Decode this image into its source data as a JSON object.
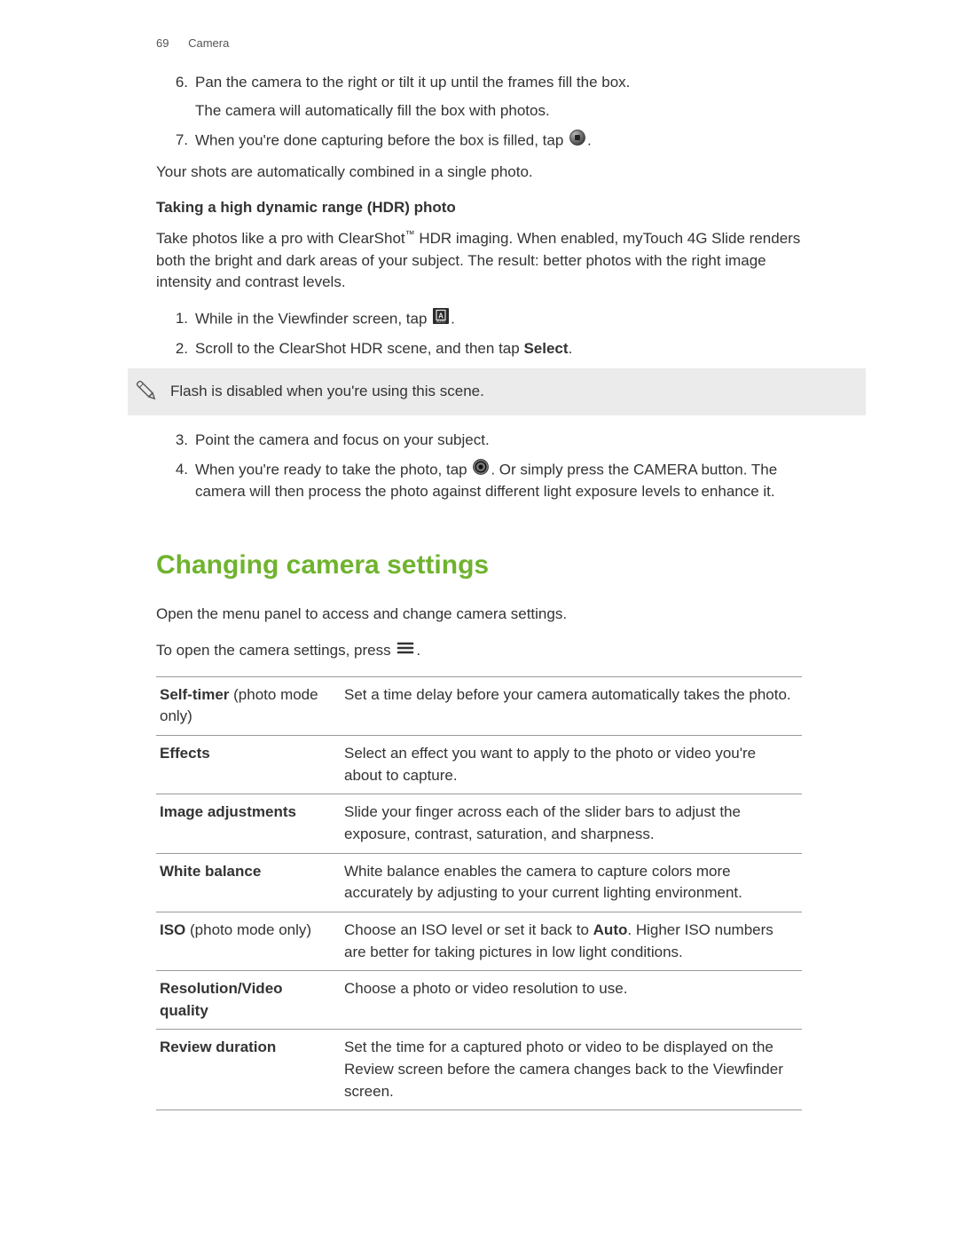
{
  "header": {
    "page_number": "69",
    "section": "Camera"
  },
  "steps_top": {
    "step6_num": "6.",
    "step6_line1": "Pan the camera to the right or tilt it up until the frames fill the box.",
    "step6_line2": "The camera will automatically fill the box with photos.",
    "step7_num": "7.",
    "step7_before": "When you're done capturing before the box is filled, tap ",
    "step7_after": "."
  },
  "after_steps": "Your shots are automatically combined in a single photo.",
  "hdr": {
    "heading": "Taking a high dynamic range (HDR) photo",
    "intro_before_tm": "Take photos like a pro with ClearShot",
    "intro_tm": "™",
    "intro_after_tm": " HDR imaging. When enabled, myTouch 4G Slide renders both the bright and dark areas of your subject. The result: better photos with the right image intensity and contrast levels.",
    "step1_num": "1.",
    "step1_before": "While in the Viewfinder screen, tap ",
    "step1_after": ".",
    "step2_num": "2.",
    "step2_before": "Scroll to the ClearShot HDR scene, and then tap ",
    "step2_bold": "Select",
    "step2_after": ".",
    "note": "Flash is disabled when you're using this scene.",
    "step3_num": "3.",
    "step3_text": "Point the camera and focus on your subject.",
    "step4_num": "4.",
    "step4_before": "When you're ready to take the photo, tap ",
    "step4_after": ". Or simply press the CAMERA button. The camera will then process the photo against different light exposure levels to enhance it."
  },
  "settings": {
    "heading": "Changing camera settings",
    "intro": "Open the menu panel to access and change camera settings.",
    "open_before": "To open the camera settings, press ",
    "open_after": ".",
    "rows": [
      {
        "name_bold": "Self-timer",
        "name_rest": " (photo mode only)",
        "desc_before": "Set a time delay before your camera automatically takes the photo.",
        "desc_bold": "",
        "desc_after": ""
      },
      {
        "name_bold": "Effects",
        "name_rest": "",
        "desc_before": "Select an effect you want to apply to the photo or video you're about to capture.",
        "desc_bold": "",
        "desc_after": ""
      },
      {
        "name_bold": "Image adjustments",
        "name_rest": "",
        "desc_before": "Slide your finger across each of the slider bars to adjust the exposure, contrast, saturation, and sharpness.",
        "desc_bold": "",
        "desc_after": ""
      },
      {
        "name_bold": "White balance",
        "name_rest": "",
        "desc_before": "White balance enables the camera to capture colors more accurately by adjusting to your current lighting environment.",
        "desc_bold": "",
        "desc_after": ""
      },
      {
        "name_bold": "ISO",
        "name_rest": " (photo mode only)",
        "desc_before": "Choose an ISO level or set it back to ",
        "desc_bold": "Auto",
        "desc_after": ". Higher ISO numbers are better for taking pictures in low light conditions."
      },
      {
        "name_bold": "Resolution/Video quality",
        "name_rest": "",
        "desc_before": "Choose a photo or video resolution to use.",
        "desc_bold": "",
        "desc_after": ""
      },
      {
        "name_bold": "Review duration",
        "name_rest": "",
        "desc_before": "Set the time for a captured photo or video to be displayed on the Review screen before the camera changes back to the Viewfinder screen.",
        "desc_bold": "",
        "desc_after": ""
      }
    ]
  },
  "icons": {
    "stop_circle": "stop-circle-icon",
    "scene_a": "scene-a-icon",
    "shutter": "shutter-icon",
    "menu": "menu-icon",
    "pen": "pen-icon"
  }
}
